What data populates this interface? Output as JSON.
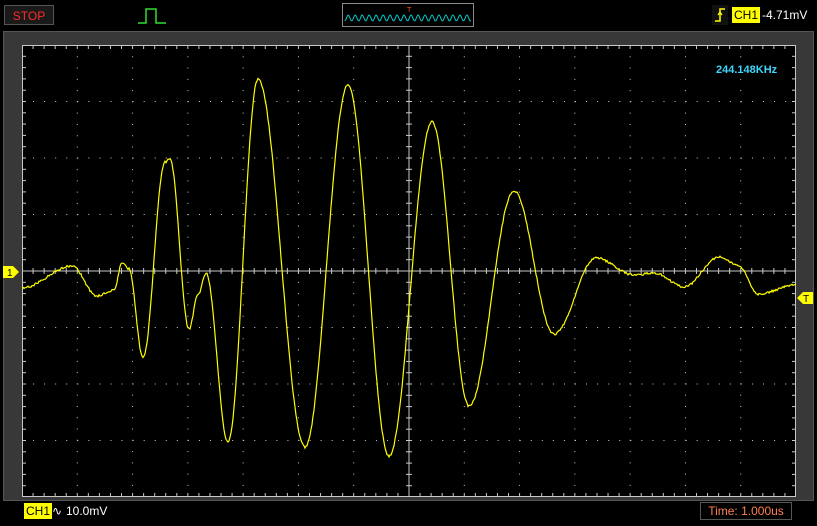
{
  "topbar": {
    "run_status": "STOP",
    "trigger_marker_label": "T",
    "trigger_channel": "CH1",
    "trigger_level": "-4.71mV"
  },
  "measurement": {
    "frequency": "244.148KHz"
  },
  "markers": {
    "channel": "1",
    "trigger": "T"
  },
  "bottombar": {
    "channel": "CH1",
    "coupling_symbol": "∿",
    "volts_per_div": "10.0mV",
    "timebase": "Time: 1.000us"
  },
  "colors": {
    "trace": "#ffff00",
    "grid": "#c8c8c8",
    "frequency": "#3fd6ff",
    "status": "#ff2a2a",
    "timebase": "#ff7f50"
  }
}
